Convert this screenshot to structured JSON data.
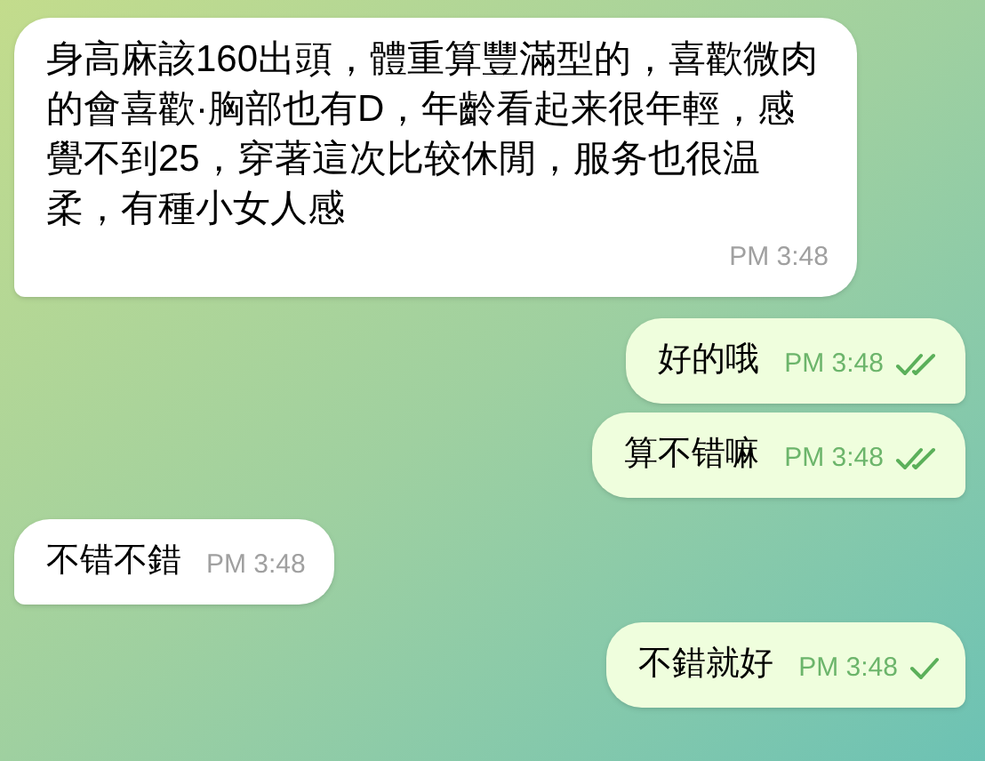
{
  "messages": [
    {
      "kind": "incoming",
      "text": "身高麻該160出頭，體重算豐滿型的，喜歡微肉的會喜歡·胸部也有D，年齡看起来很年輕，感覺不到25，穿著這次比较休閒，服务也很温柔，有種小女人感",
      "time": "PM 3:48"
    },
    {
      "kind": "outgoing",
      "text": "好的哦",
      "time": "PM 3:48",
      "read": true
    },
    {
      "kind": "outgoing",
      "text": "算不错嘛",
      "time": "PM 3:48",
      "read": true
    },
    {
      "kind": "incoming",
      "text": "不错不錯",
      "time": "PM 3:48"
    },
    {
      "kind": "outgoing",
      "text": "不錯就好",
      "time": "PM 3:48",
      "read": false
    }
  ]
}
